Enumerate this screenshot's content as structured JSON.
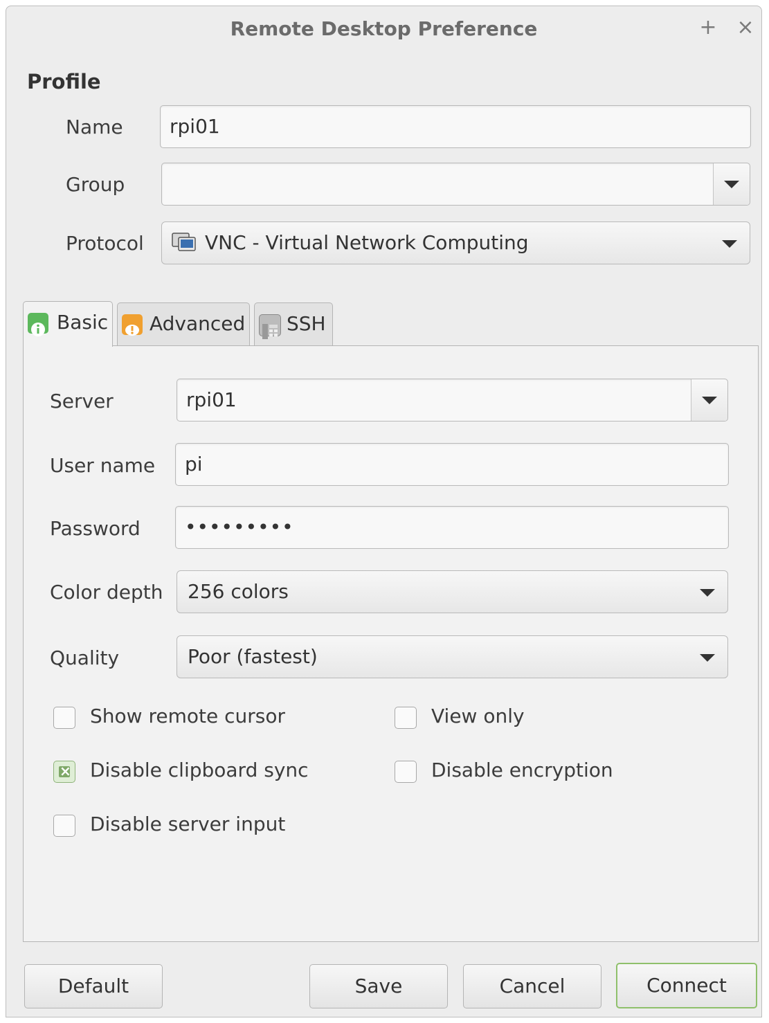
{
  "window": {
    "title": "Remote Desktop Preference",
    "pin_glyph": "+",
    "close_glyph": "×"
  },
  "profile": {
    "section_title": "Profile",
    "name_label": "Name",
    "name_value": "rpi01",
    "group_label": "Group",
    "group_value": "",
    "protocol_label": "Protocol",
    "protocol_value": "VNC - Virtual Network Computing",
    "protocol_icon": "monitor-network-icon"
  },
  "tabs": [
    {
      "label": "Basic",
      "icon": "info-icon",
      "color": "#5cb85c",
      "active": true
    },
    {
      "label": "Advanced",
      "icon": "warning-icon",
      "color": "#f0a030",
      "active": false
    },
    {
      "label": "SSH",
      "icon": "terminal-icon",
      "color": "#9a9a9a",
      "active": false
    }
  ],
  "basic": {
    "server_label": "Server",
    "server_value": "rpi01",
    "username_label": "User name",
    "username_value": "pi",
    "password_label": "Password",
    "password_value": "•••••••••",
    "colordepth_label": "Color depth",
    "colordepth_value": "256 colors",
    "quality_label": "Quality",
    "quality_value": "Poor (fastest)",
    "checks": {
      "show_cursor": {
        "label": "Show remote cursor",
        "checked": false
      },
      "view_only": {
        "label": "View only",
        "checked": false
      },
      "disable_clipboard": {
        "label": "Disable clipboard sync",
        "checked": true
      },
      "disable_encryption": {
        "label": "Disable encryption",
        "checked": false
      },
      "disable_input": {
        "label": "Disable server input",
        "checked": false
      }
    }
  },
  "buttons": {
    "default": "Default",
    "save": "Save",
    "cancel": "Cancel",
    "connect": "Connect"
  },
  "colors": {
    "accent_green": "#8fc06b",
    "window_bg": "#ededed"
  }
}
